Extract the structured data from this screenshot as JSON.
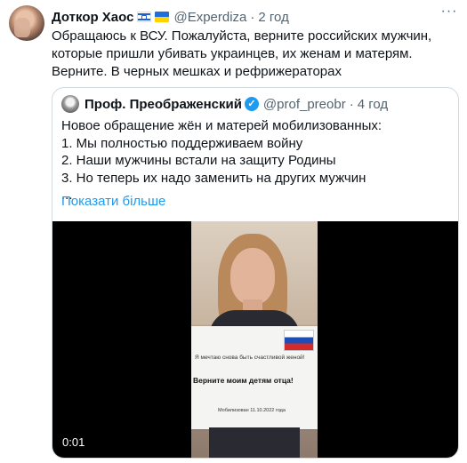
{
  "tweet": {
    "author": "Доткор Хаос",
    "handle": "@Experdiza",
    "separator": "·",
    "time": "2 год",
    "more_glyph": "···",
    "text": "Обращаюсь к ВСУ. Пожалуйста, верните российских мужчин, которые пришли убивать украинцев, их женам и матерям. Верните. В черных мешках и рефрижераторах"
  },
  "quote": {
    "author": "Проф. Преображенский",
    "verified_glyph": "✓",
    "handle": "@prof_preobr",
    "separator": "·",
    "time": "4 год",
    "lines": [
      "Новое обращение жён и матерей мобилизованных:",
      "1. Мы полностью поддерживаем войну",
      "2. Наши мужчины встали на защиту Родины",
      "3. Но теперь их надо заменить на других мужчин",
      "..."
    ],
    "show_more": "Показати більше"
  },
  "video": {
    "sign_line1": "Я мечтаю снова быть счастливой женой!",
    "sign_line2": "Верните моим детям отца!",
    "sign_line3": "Мобилизован 11.10.2022 года",
    "timestamp": "0:01"
  },
  "colors": {
    "accent": "#1d9bf0",
    "text": "#0f1419",
    "secondary": "#536471",
    "border": "#cfd9de"
  },
  "icons": {
    "more": "more-horizontal-icon",
    "verified": "verified-badge-icon",
    "flags": [
      "israel-flag-icon",
      "ukraine-flag-icon"
    ]
  }
}
